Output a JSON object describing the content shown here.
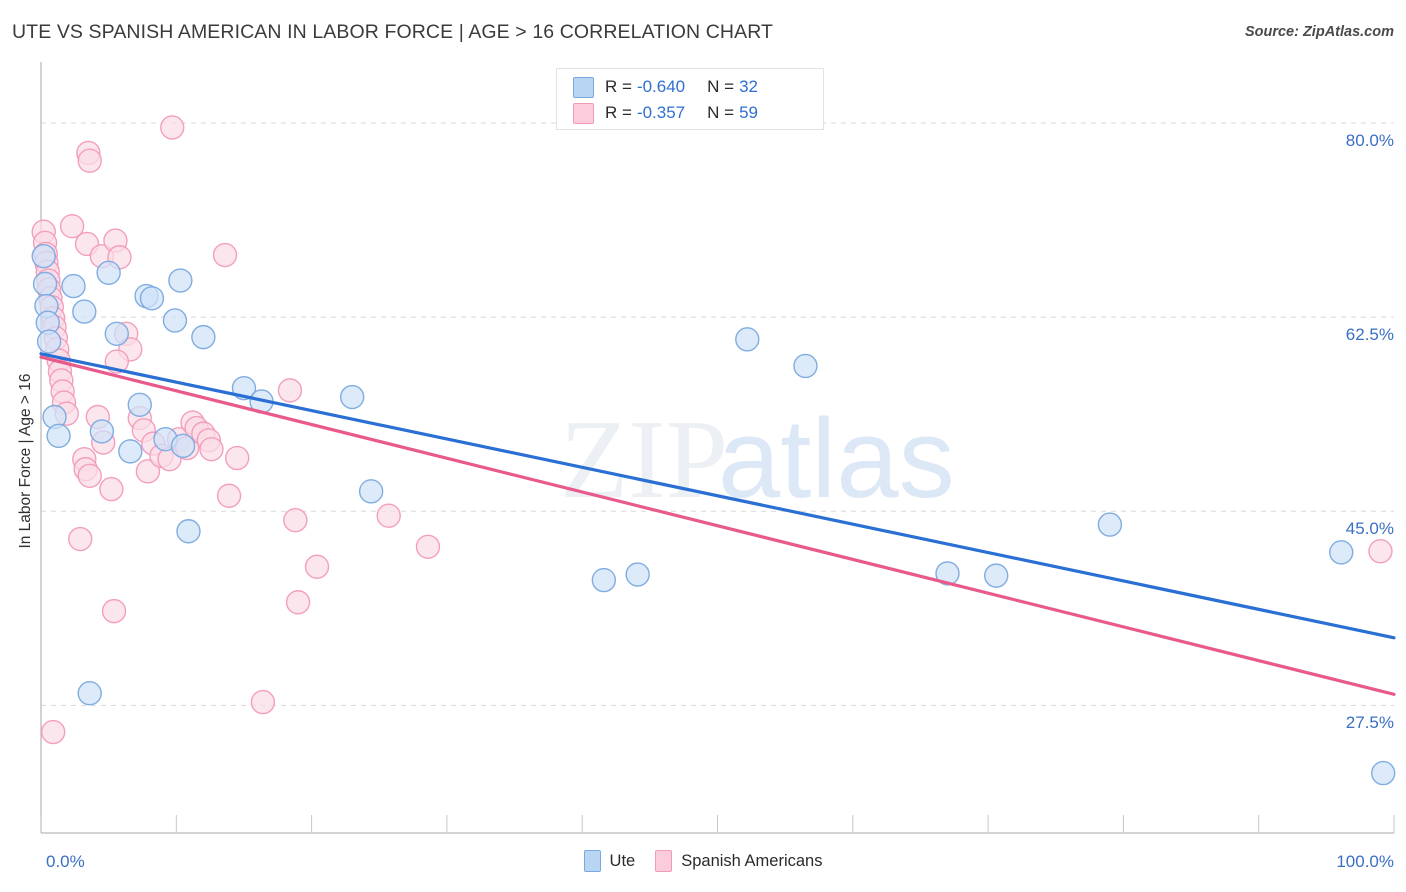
{
  "header": {
    "title": "UTE VS SPANISH AMERICAN IN LABOR FORCE | AGE > 16 CORRELATION CHART",
    "source": "Source: ZipAtlas.com"
  },
  "watermark": {
    "part1": "ZIP",
    "part2": "atlas"
  },
  "stats_legend": {
    "rows": [
      {
        "series": "Ute",
        "color": "#b9d5f4",
        "r_label": "R =",
        "r_value": "-0.640",
        "n_label": "N =",
        "n_value": "32"
      },
      {
        "series": "Spanish Americans",
        "color": "#fbcddc",
        "r_label": "R =",
        "r_value": "-0.357",
        "n_label": "N =",
        "n_value": "59"
      }
    ]
  },
  "bottom_legend": {
    "items": [
      {
        "label": "Ute",
        "color": "#b9d5f4"
      },
      {
        "label": "Spanish Americans",
        "color": "#fbcddc"
      }
    ]
  },
  "axes": {
    "x_min_label": "0.0%",
    "x_max_label": "100.0%",
    "y_ticks": [
      "80.0%",
      "62.5%",
      "45.0%",
      "27.5%"
    ],
    "y_title": "In Labor Force | Age > 16"
  },
  "chart_data": {
    "type": "scatter",
    "title": "UTE VS SPANISH AMERICAN IN LABOR FORCE | AGE > 16 CORRELATION CHART",
    "xlabel": "",
    "ylabel": "In Labor Force | Age > 16",
    "xlim": [
      0,
      100
    ],
    "ylim": [
      16.0,
      85.5
    ],
    "x_ticks": [
      0,
      100
    ],
    "y_ticks": [
      27.5,
      45.0,
      62.5,
      80.0
    ],
    "grid": "horizontal-dashed",
    "legend_position": "bottom-center",
    "colors": {
      "ute_fill": "#cfe2f8",
      "ute_stroke": "#7aa9de",
      "spanish_fill": "#fbdce6",
      "spanish_stroke": "#f29ab9",
      "ute_line": "#2a6fd4",
      "spanish_line": "#e8598c",
      "tick_text": "#3a6fc4",
      "grid_line": "#d8d8d8"
    },
    "series": [
      {
        "name": "Ute",
        "r": -0.64,
        "n": 32,
        "marker_color": "#cfe2f8",
        "trendline": {
          "x0": 0.0,
          "y0": 59.2,
          "x1": 100.0,
          "y1": 33.6
        },
        "points": [
          [
            0.2,
            68.0
          ],
          [
            0.3,
            65.5
          ],
          [
            0.4,
            63.5
          ],
          [
            0.5,
            62.0
          ],
          [
            0.6,
            60.3
          ],
          [
            1.0,
            53.5
          ],
          [
            1.3,
            51.8
          ],
          [
            2.4,
            65.3
          ],
          [
            3.2,
            63.0
          ],
          [
            4.5,
            52.2
          ],
          [
            5.0,
            66.5
          ],
          [
            5.6,
            61.0
          ],
          [
            6.6,
            50.4
          ],
          [
            7.3,
            54.6
          ],
          [
            7.8,
            64.4
          ],
          [
            8.2,
            64.2
          ],
          [
            9.2,
            51.5
          ],
          [
            9.9,
            62.2
          ],
          [
            10.3,
            65.8
          ],
          [
            10.5,
            50.9
          ],
          [
            10.9,
            43.2
          ],
          [
            12.0,
            60.7
          ],
          [
            15.0,
            56.1
          ],
          [
            16.3,
            54.9
          ],
          [
            23.0,
            55.3
          ],
          [
            24.4,
            46.8
          ],
          [
            3.6,
            28.6
          ],
          [
            41.6,
            38.8
          ],
          [
            44.1,
            39.3
          ],
          [
            52.2,
            60.5
          ],
          [
            56.5,
            58.1
          ],
          [
            67.0,
            39.4
          ],
          [
            70.6,
            39.2
          ],
          [
            79.0,
            43.8
          ],
          [
            96.1,
            41.3
          ],
          [
            99.2,
            21.4
          ]
        ]
      },
      {
        "name": "Spanish Americans",
        "r": -0.357,
        "n": 59,
        "marker_color": "#fbdce6",
        "trendline": {
          "x0": 0.0,
          "y0": 58.9,
          "x1": 100.0,
          "y1": 28.5
        },
        "points": [
          [
            0.2,
            70.2
          ],
          [
            0.3,
            69.2
          ],
          [
            0.35,
            68.2
          ],
          [
            0.4,
            67.4
          ],
          [
            0.5,
            66.6
          ],
          [
            0.55,
            65.8
          ],
          [
            0.6,
            65.0
          ],
          [
            0.7,
            64.2
          ],
          [
            0.8,
            63.4
          ],
          [
            0.9,
            62.4
          ],
          [
            1.0,
            61.6
          ],
          [
            1.1,
            60.6
          ],
          [
            1.2,
            59.6
          ],
          [
            1.3,
            58.6
          ],
          [
            1.4,
            57.6
          ],
          [
            1.5,
            56.8
          ],
          [
            1.6,
            55.8
          ],
          [
            1.7,
            54.8
          ],
          [
            1.9,
            53.8
          ],
          [
            3.5,
            77.3
          ],
          [
            3.6,
            76.6
          ],
          [
            2.3,
            70.7
          ],
          [
            3.4,
            69.1
          ],
          [
            4.5,
            68.0
          ],
          [
            5.5,
            69.4
          ],
          [
            5.8,
            67.9
          ],
          [
            6.3,
            61.0
          ],
          [
            6.6,
            59.6
          ],
          [
            5.6,
            58.5
          ],
          [
            4.2,
            53.5
          ],
          [
            4.6,
            51.2
          ],
          [
            3.2,
            49.7
          ],
          [
            3.3,
            48.8
          ],
          [
            3.6,
            48.2
          ],
          [
            2.9,
            42.5
          ],
          [
            5.2,
            47.0
          ],
          [
            5.4,
            36.0
          ],
          [
            7.3,
            53.4
          ],
          [
            7.6,
            52.3
          ],
          [
            7.9,
            48.6
          ],
          [
            8.3,
            51.1
          ],
          [
            8.9,
            50.0
          ],
          [
            9.5,
            49.7
          ],
          [
            10.2,
            51.5
          ],
          [
            10.8,
            50.7
          ],
          [
            11.2,
            53.0
          ],
          [
            11.5,
            52.5
          ],
          [
            12.0,
            52.0
          ],
          [
            12.4,
            51.4
          ],
          [
            12.6,
            50.6
          ],
          [
            9.7,
            79.6
          ],
          [
            13.6,
            68.1
          ],
          [
            13.9,
            46.4
          ],
          [
            14.5,
            49.8
          ],
          [
            16.4,
            27.8
          ],
          [
            18.4,
            55.9
          ],
          [
            18.8,
            44.2
          ],
          [
            20.4,
            40.0
          ],
          [
            19.0,
            36.8
          ],
          [
            25.7,
            44.6
          ],
          [
            28.6,
            41.8
          ],
          [
            0.9,
            25.1
          ],
          [
            99.0,
            41.4
          ]
        ]
      }
    ]
  }
}
